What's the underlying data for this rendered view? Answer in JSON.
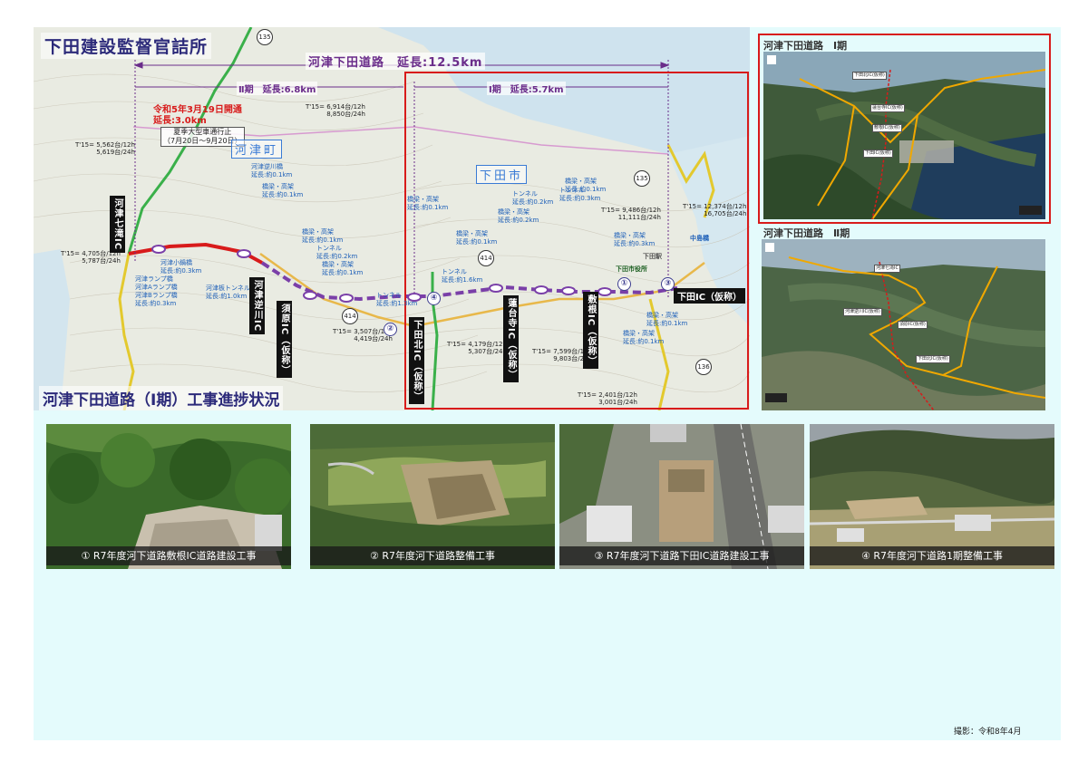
{
  "main_map": {
    "office_name": "下田建設監督官詰所",
    "road_title": "河津下田道路　延長:12.5km",
    "phase2_length": "Ⅱ期　延長:6.8km",
    "phase1_length": "Ⅰ期　延長:5.7km",
    "opening_note_line1": "令和5年3月19日開通",
    "opening_note_line2": "延長:3.0km",
    "closure_note_line1": "夏季大型車通行止",
    "closure_note_line2": "（7月20日～9月20日）",
    "town_kawazu": "河津町",
    "town_shimoda": "下田市",
    "progress_title": "河津下田道路（Ⅰ期）工事進捗状況",
    "labels": {
      "kawazu_nanataki_ic": "河津七滝IC",
      "kawazu_sakagawa_ic": "河津逆川IC",
      "subara_ic": "須原IC（仮称）",
      "shimoda_kita_ic": "下田北IC（仮称）",
      "rendaiji_ic": "蓮台寺IC（仮称）",
      "shikine_ic": "敷根IC（仮称）",
      "shimoda_ic": "下田IC（仮称）"
    },
    "markers": [
      "①",
      "②",
      "③",
      "④"
    ],
    "route_numbers": [
      "135",
      "414",
      "136"
    ],
    "traffic_counts": [
      "T'15= 6,914台/12h\n8,850台/24h",
      "T'15= 5,562台/12h\n5,619台/24h",
      "T'15= 4,705台/12h\n5,787台/24h",
      "T'15= 3,507台/12h\n4,419台/24h",
      "T'15= 4,179台/12h\n5,307台/24h",
      "T'15= 7,599台/12h\n9,803台/24h",
      "T'15= 9,486台/12h\n11,111台/24h",
      "T'15= 12,374台/12h\n16,705台/24h",
      "T'15= 2,401台/12h\n3,001台/24h"
    ],
    "structure_notes": [
      "河津逆川橋\n延長:約0.1km",
      "橋梁・高架\n延長:約0.1km",
      "河津小鍋橋\n延長:約0.3km",
      "河津ランプ橋\n河津Aランプ橋\n河津Bランプ橋\n延長:約0.3km",
      "河津板トンネル\n延長:約1.0km",
      "橋梁・高架\n延長:約0.1km",
      "トンネル\n延長:約0.2km",
      "トンネル\n延長:約1.3km",
      "橋梁・高架\n延長:約0.1km",
      "橋梁・高架\n延長:約0.1km",
      "トンネル\n延長:約1.6km",
      "橋梁・高架\n延長:約0.1km",
      "トンネル\n延長:約0.2km",
      "橋梁・高架\n延長:約0.2km",
      "トンネル\n延長:約0.3km",
      "橋梁・高架\n延長:約0.1km",
      "橋梁・高架\n延長:約0.3km",
      "橋梁・高架\n延長:約0.1km",
      "橋梁・高架\n延長:約0.1km"
    ],
    "small_labels": [
      "中島橋",
      "下田市役所",
      "下田駅"
    ]
  },
  "aerial_phase1": {
    "title": "河津下田道路　Ⅰ期",
    "pins": [
      "下田北IC(仮称)",
      "蓮台寺IC(仮称)",
      "敷根IC(仮称)",
      "下田IC(仮称)"
    ]
  },
  "aerial_phase2": {
    "title": "河津下田道路　Ⅱ期",
    "pins": [
      "河津七滝IC",
      "河津逆川IC(仮称)",
      "須原IC(仮称)",
      "下田北IC(仮称)"
    ]
  },
  "photos": [
    {
      "caption": "① R7年度河下道路敷根IC道路建設工事"
    },
    {
      "caption": "② R7年度河下道路整備工事"
    },
    {
      "caption": "③ R7年度河下道路下田IC道路建設工事"
    },
    {
      "caption": "④ R7年度河下道路1期整備工事"
    }
  ],
  "credit": "撮影：令和8年4月",
  "colors": {
    "page_bg": "#e4fbfc",
    "highlight_frame": "#d81b1b",
    "phase1_route": "#7a3fa8",
    "opened_route": "#d81b1b",
    "title_text": "#2c2a7a"
  }
}
